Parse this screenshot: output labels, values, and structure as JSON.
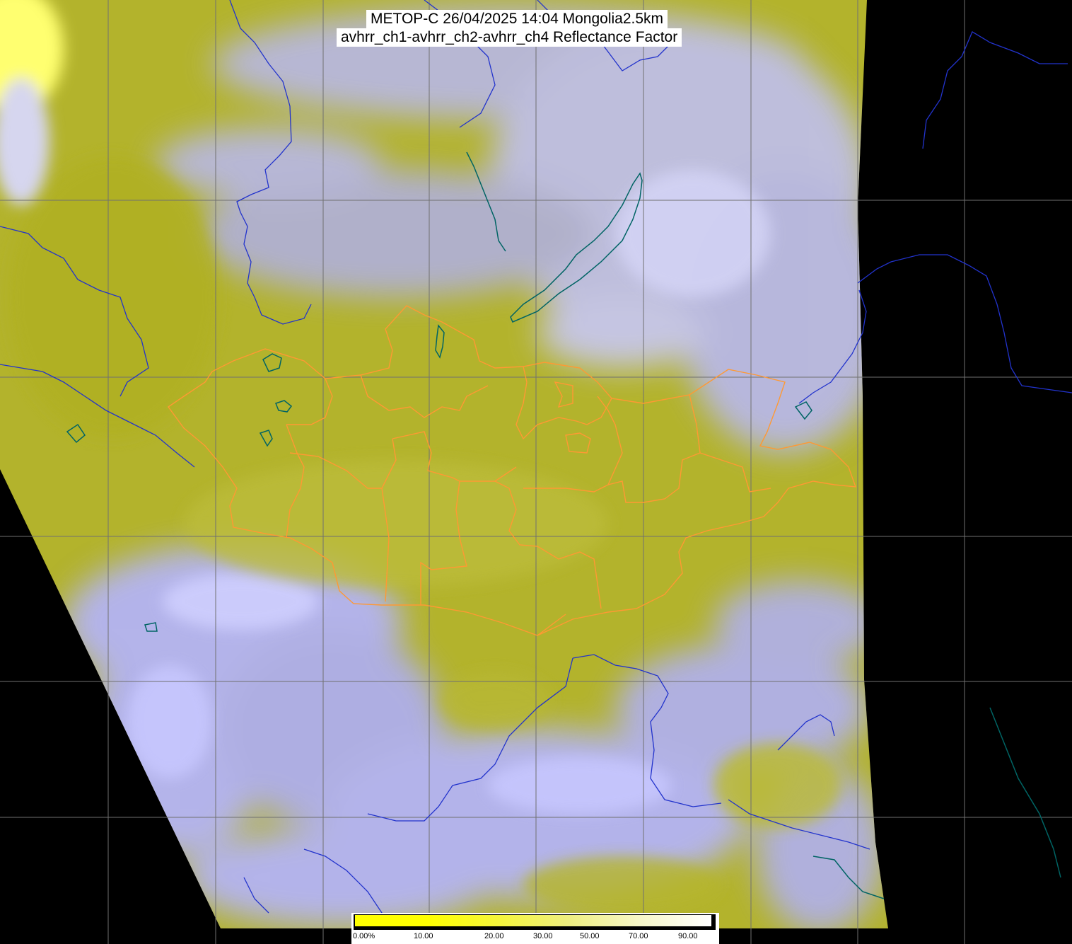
{
  "header": {
    "title_line_1": "METOP-C 26/04/2025 14:04 Mongolia2.5km",
    "title_line_2": "avhrr_ch1-avhrr_ch2-avhrr_ch4 Reflectance Factor"
  },
  "colorbar": {
    "labels": [
      "0.00%",
      "10.00",
      "20.00",
      "30.00",
      "50.00",
      "70.00",
      "90.00"
    ],
    "min_percent": 0,
    "max_percent": 100,
    "color_stops": [
      "#ffff00",
      "#ffff00",
      "#f5f53a",
      "#eeee80",
      "#f6f6c8",
      "#ffffff"
    ]
  },
  "colors": {
    "background_no_data": "#000000",
    "surface_olive": "#b5b52a",
    "cloud_lavender": "#b4b4ff",
    "cloud_white": "#dcdcf0",
    "grid_lines": "#707070",
    "country_borders": "#2233cc",
    "mongolia_borders": "#ff9933",
    "water_bodies": "#006464"
  },
  "map": {
    "satellite": "METOP-C",
    "region": "Mongolia",
    "features": [
      "swath-imagery",
      "lat-lon-grid",
      "country-borders",
      "mongolia-aimag-borders",
      "lake-baikal",
      "lakes-coastlines"
    ]
  }
}
